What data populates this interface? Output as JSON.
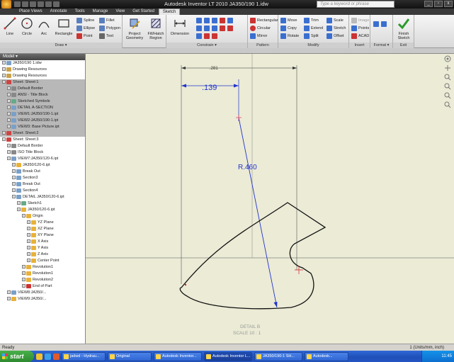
{
  "app": {
    "title": "Autodesk Inventor LT 2010    JA350/190 1.idw",
    "search_placeholder": "Type a keyword or phrase",
    "window_controls": [
      "_",
      "▫",
      "x"
    ]
  },
  "tabs": [
    "Place Views",
    "Annotate",
    "Tools",
    "Manage",
    "View",
    "Get Started",
    "Sketch"
  ],
  "active_tab": "Sketch",
  "ribbon": {
    "draw": {
      "title": "Draw ▾",
      "buttons": [
        "Line",
        "Circle",
        "Arc",
        "Rectangle"
      ],
      "small": [
        "Spline",
        "Fillet",
        "Ellipse",
        "Polygon",
        "Point",
        "Text"
      ]
    },
    "insert": {
      "buttons": [
        "Project Geometry",
        "Fill/Hatch Region"
      ]
    },
    "constrain": {
      "title": "Constrain ▾",
      "buttons": [
        "Dimension"
      ]
    },
    "pattern": {
      "title": "Pattern",
      "small": [
        "Rectangular",
        "Circular",
        "Mirror"
      ]
    },
    "modify": {
      "title": "Modify",
      "small": [
        "Move",
        "Trim",
        "Scale",
        "Copy",
        "Extend",
        "Stretch",
        "Rotate",
        "Split",
        "Offset"
      ]
    },
    "insert2": {
      "title": "Insert",
      "small": [
        "Image",
        "Points",
        "ACAD"
      ]
    },
    "format": {
      "title": "Format ▾"
    },
    "exit": {
      "title": "Exit",
      "button": "Finish Sketch"
    }
  },
  "browser": {
    "header": "Model ▾",
    "nodes": [
      {
        "label": "JA350/190 1.idw",
        "level": 0,
        "sel": false,
        "icon": "#7aa0c8"
      },
      {
        "label": "Drawing Resources",
        "level": 0,
        "sel": false,
        "icon": "#c9a24a"
      },
      {
        "label": "Drawing Resources",
        "level": 0,
        "sel": false,
        "icon": "#c9a24a"
      },
      {
        "label": "Sheet: Sheet:1",
        "level": 0,
        "sel": true,
        "icon": "#c44"
      },
      {
        "label": "Default Border",
        "level": 1,
        "sel": true,
        "icon": "#888"
      },
      {
        "label": "ANSI - Title Block",
        "level": 1,
        "sel": true,
        "icon": "#888"
      },
      {
        "label": "Sketched Symbols",
        "level": 1,
        "sel": true,
        "icon": "#6a8"
      },
      {
        "label": "DETAIL A-SECTION",
        "level": 1,
        "sel": true,
        "icon": "#7aa0c8"
      },
      {
        "label": "VIEW1:JA350/190-1.ipt",
        "level": 1,
        "sel": true,
        "icon": "#7aa0c8"
      },
      {
        "label": "VIEW2:JA350/190-1.ipt",
        "level": 1,
        "sel": true,
        "icon": "#7aa0c8"
      },
      {
        "label": "VIEW3: Base Picture.ipt",
        "level": 1,
        "sel": true,
        "icon": "#7aa0c8"
      },
      {
        "label": "Sheet: Sheet:2",
        "level": 0,
        "sel": true,
        "icon": "#c44"
      },
      {
        "label": "Sheet: Sheet:3",
        "level": 0,
        "sel": false,
        "icon": "#c44"
      },
      {
        "label": "Default Border",
        "level": 1,
        "sel": false,
        "icon": "#888"
      },
      {
        "label": "ISO Title Block",
        "level": 1,
        "sel": false,
        "icon": "#888"
      },
      {
        "label": "VIEW7:JA350/120-6.ipt",
        "level": 1,
        "sel": false,
        "icon": "#7aa0c8"
      },
      {
        "label": "JA350/120-6.ipt",
        "level": 2,
        "sel": false,
        "icon": "#e8b23a"
      },
      {
        "label": "Break Out",
        "level": 2,
        "sel": false,
        "icon": "#7aa0c8"
      },
      {
        "label": "Section3",
        "level": 2,
        "sel": false,
        "icon": "#7aa0c8"
      },
      {
        "label": "Break Out",
        "level": 2,
        "sel": false,
        "icon": "#7aa0c8"
      },
      {
        "label": "Section4",
        "level": 2,
        "sel": false,
        "icon": "#7aa0c8"
      },
      {
        "label": "DETAIL JA350/120-6.ipt",
        "level": 2,
        "sel": false,
        "icon": "#7aa0c8"
      },
      {
        "label": "Sketch1",
        "level": 3,
        "sel": false,
        "icon": "#6a8"
      },
      {
        "label": "JA350/120-6.ipt",
        "level": 3,
        "sel": false,
        "icon": "#e8b23a"
      },
      {
        "label": "Origin",
        "level": 4,
        "sel": false,
        "icon": "#e8b23a"
      },
      {
        "label": "YZ Plane",
        "level": 5,
        "sel": false,
        "icon": "#e8b23a"
      },
      {
        "label": "XZ Plane",
        "level": 5,
        "sel": false,
        "icon": "#e8b23a"
      },
      {
        "label": "XY Plane",
        "level": 5,
        "sel": false,
        "icon": "#e8b23a"
      },
      {
        "label": "X Axis",
        "level": 5,
        "sel": false,
        "icon": "#e8b23a"
      },
      {
        "label": "Y Axis",
        "level": 5,
        "sel": false,
        "icon": "#e8b23a"
      },
      {
        "label": "Z Axis",
        "level": 5,
        "sel": false,
        "icon": "#e8b23a"
      },
      {
        "label": "Center Point",
        "level": 5,
        "sel": false,
        "icon": "#e8b23a"
      },
      {
        "label": "Revolution1",
        "level": 4,
        "sel": false,
        "icon": "#e8b23a"
      },
      {
        "label": "Revolution1",
        "level": 4,
        "sel": false,
        "icon": "#e8b23a"
      },
      {
        "label": "Revolution2",
        "level": 4,
        "sel": false,
        "icon": "#e8b23a"
      },
      {
        "label": "End of Part",
        "level": 4,
        "sel": false,
        "icon": "#c33"
      },
      {
        "label": "VIEW8:JA350/...",
        "level": 1,
        "sel": false,
        "icon": "#7aa0c8"
      },
      {
        "label": "VIEW9:JA350/...",
        "level": 1,
        "sel": false,
        "icon": "#e8b23a"
      }
    ]
  },
  "drawing": {
    "dim_horizontal": ".281",
    "dim_139": ".139",
    "dim_radius": "R.460",
    "detail_label": "DETAIL B",
    "scale_label": "SCALE 10 : 1"
  },
  "status": {
    "left": "Ready",
    "right": "1  (Units/mm, inch)"
  },
  "taskbar": {
    "start": "start",
    "tasks": [
      "jadwd - Hydrau...",
      "Original",
      "Autodesk Inventor...",
      "Autodesk Inventor L...",
      "JA350/190-1 SH...",
      "Autodesk..."
    ],
    "active_task": 3,
    "clock": "11:45"
  },
  "colors": {
    "canvas": "#ebebd6",
    "sketch_line": "#111111",
    "dimension": "#2233cc",
    "selection_gray": "#b8b8b8"
  }
}
